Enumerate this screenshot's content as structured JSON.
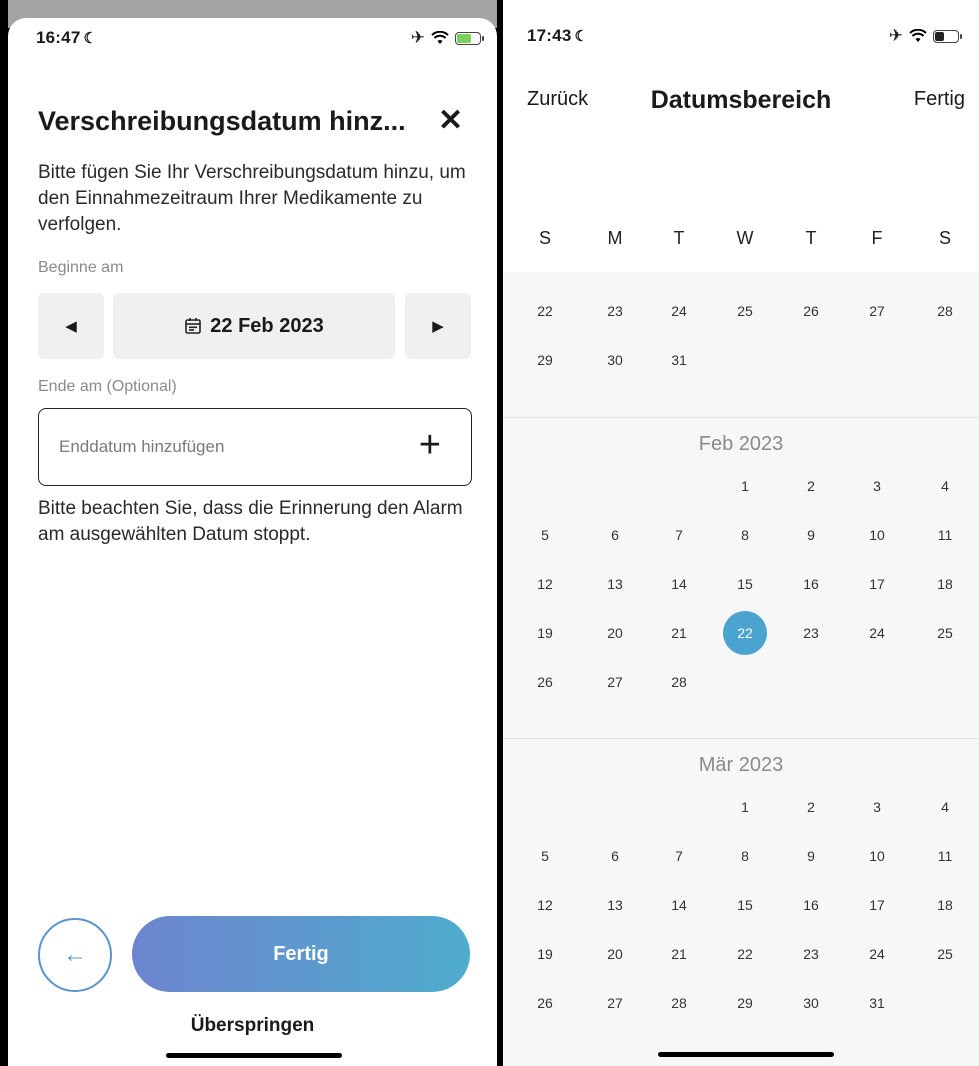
{
  "left": {
    "status": {
      "time": "16:47",
      "moon": "☾",
      "airplane": "✈",
      "wifi": "wifi-icon",
      "battery_color": "#7bd15a"
    },
    "title": "Verschreibungsdatum hinz...",
    "close": "✕",
    "intro": "Bitte fügen Sie Ihr Verschreibungsdatum hinzu, um den Einnahmezeitraum Ihrer Medikamente zu verfolgen.",
    "start_label": "Beginne am",
    "prev": "◀",
    "next": "▶",
    "start_date": "22 Feb 2023",
    "end_label": "Ende am (Optional)",
    "end_placeholder": "Enddatum hinzufügen",
    "plus": "+",
    "note": "Bitte beachten Sie, dass die Erinnerung den Alarm am ausgewählten Datum stoppt.",
    "back_arrow": "←",
    "done": "Fertig",
    "skip": "Überspringen"
  },
  "right": {
    "status": {
      "time": "17:43",
      "moon": "☾",
      "airplane": "✈"
    },
    "back": "Zurück",
    "title": "Datumsbereich",
    "done": "Fertig",
    "weekdays": [
      "S",
      "M",
      "T",
      "W",
      "T",
      "F",
      "S"
    ],
    "prev_month_rows": [
      [
        "22",
        "23",
        "24",
        "25",
        "26",
        "27",
        "28"
      ],
      [
        "29",
        "30",
        "31",
        "",
        "",
        "",
        ""
      ]
    ],
    "months": [
      {
        "title": "Feb 2023",
        "rows": [
          [
            "",
            "",
            "",
            "1",
            "2",
            "3",
            "4"
          ],
          [
            "5",
            "6",
            "7",
            "8",
            "9",
            "10",
            "11"
          ],
          [
            "12",
            "13",
            "14",
            "15",
            "16",
            "17",
            "18"
          ],
          [
            "19",
            "20",
            "21",
            "22",
            "23",
            "24",
            "25"
          ],
          [
            "26",
            "27",
            "28",
            "",
            "",
            "",
            ""
          ]
        ],
        "selected": "22"
      },
      {
        "title": "Mär 2023",
        "rows": [
          [
            "",
            "",
            "",
            "1",
            "2",
            "3",
            "4"
          ],
          [
            "5",
            "6",
            "7",
            "8",
            "9",
            "10",
            "11"
          ],
          [
            "12",
            "13",
            "14",
            "15",
            "16",
            "17",
            "18"
          ],
          [
            "19",
            "20",
            "21",
            "22",
            "23",
            "24",
            "25"
          ],
          [
            "26",
            "27",
            "28",
            "29",
            "30",
            "31",
            ""
          ]
        ],
        "selected": ""
      }
    ],
    "accent": "#4ba3cf"
  }
}
